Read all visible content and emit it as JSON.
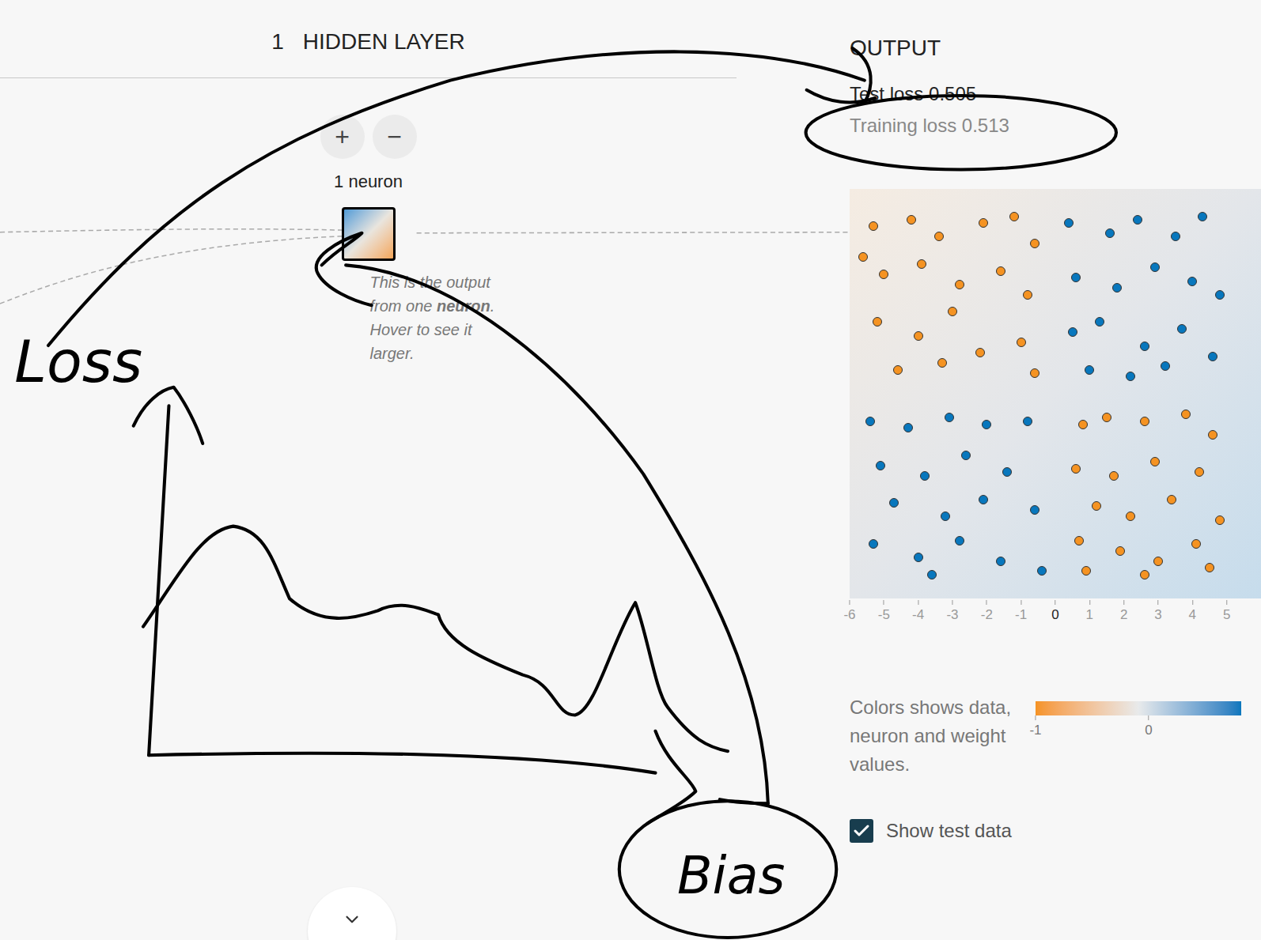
{
  "hidden_layer": {
    "count": "1",
    "title": "HIDDEN LAYER",
    "buttons": [
      "+",
      "−"
    ],
    "neurons_label": "1 neuron",
    "callout": [
      {
        "text": "This is the output from one ",
        "bold": false
      },
      {
        "text": "neuron",
        "bold": true
      },
      {
        "text": ". Hover to see it larger.",
        "bold": false
      }
    ]
  },
  "output": {
    "title": "OUTPUT",
    "test_loss": "Test loss 0.505",
    "training_loss": "Training loss 0.513"
  },
  "chart": {
    "x_ticks": [
      "-6",
      "-5",
      "-4",
      "-3",
      "-2",
      "-1",
      "0",
      "1",
      "2",
      "3",
      "4",
      "5"
    ],
    "series": [
      {
        "name": "orange",
        "color": "#f59322",
        "points": [
          [
            -5.3,
            4.9
          ],
          [
            -4.2,
            5.1
          ],
          [
            -3.4,
            4.6
          ],
          [
            -2.1,
            5.0
          ],
          [
            -1.2,
            5.2
          ],
          [
            -0.6,
            4.4
          ],
          [
            -5.0,
            3.5
          ],
          [
            -3.9,
            3.8
          ],
          [
            -2.8,
            3.2
          ],
          [
            -1.6,
            3.6
          ],
          [
            -0.8,
            2.9
          ],
          [
            -5.2,
            2.1
          ],
          [
            -4.0,
            1.7
          ],
          [
            -3.0,
            2.4
          ],
          [
            -2.2,
            1.2
          ],
          [
            -1.0,
            1.5
          ],
          [
            -4.6,
            0.7
          ],
          [
            -3.3,
            0.9
          ],
          [
            -0.6,
            0.6
          ],
          [
            -5.6,
            4.0
          ],
          [
            0.8,
            -0.9
          ],
          [
            1.5,
            -0.7
          ],
          [
            2.6,
            -0.8
          ],
          [
            3.8,
            -0.6
          ],
          [
            4.6,
            -1.2
          ],
          [
            0.6,
            -2.2
          ],
          [
            1.7,
            -2.4
          ],
          [
            2.9,
            -2.0
          ],
          [
            4.2,
            -2.3
          ],
          [
            1.2,
            -3.3
          ],
          [
            2.2,
            -3.6
          ],
          [
            3.4,
            -3.1
          ],
          [
            4.8,
            -3.7
          ],
          [
            0.7,
            -4.3
          ],
          [
            1.9,
            -4.6
          ],
          [
            3.0,
            -4.9
          ],
          [
            4.1,
            -4.4
          ],
          [
            0.9,
            -5.2
          ],
          [
            2.6,
            -5.3
          ],
          [
            4.5,
            -5.1
          ]
        ]
      },
      {
        "name": "blue",
        "color": "#0877bd",
        "points": [
          [
            0.4,
            5.0
          ],
          [
            1.6,
            4.7
          ],
          [
            2.4,
            5.1
          ],
          [
            3.5,
            4.6
          ],
          [
            4.3,
            5.2
          ],
          [
            0.6,
            3.4
          ],
          [
            1.8,
            3.1
          ],
          [
            2.9,
            3.7
          ],
          [
            4.0,
            3.3
          ],
          [
            4.8,
            2.9
          ],
          [
            0.5,
            1.8
          ],
          [
            1.3,
            2.1
          ],
          [
            2.6,
            1.4
          ],
          [
            3.7,
            1.9
          ],
          [
            4.6,
            1.1
          ],
          [
            1.0,
            0.7
          ],
          [
            2.2,
            0.5
          ],
          [
            3.2,
            0.8
          ],
          [
            -5.4,
            -0.8
          ],
          [
            -4.3,
            -1.0
          ],
          [
            -3.1,
            -0.7
          ],
          [
            -2.0,
            -0.9
          ],
          [
            -0.8,
            -0.8
          ],
          [
            -5.1,
            -2.1
          ],
          [
            -3.8,
            -2.4
          ],
          [
            -2.6,
            -1.8
          ],
          [
            -1.4,
            -2.3
          ],
          [
            -4.7,
            -3.2
          ],
          [
            -3.2,
            -3.6
          ],
          [
            -2.1,
            -3.1
          ],
          [
            -0.6,
            -3.4
          ],
          [
            -5.3,
            -4.4
          ],
          [
            -4.0,
            -4.8
          ],
          [
            -2.8,
            -4.3
          ],
          [
            -1.6,
            -4.9
          ],
          [
            -0.4,
            -5.2
          ],
          [
            -3.6,
            -5.3
          ]
        ]
      }
    ]
  },
  "legend": {
    "text": "Colors shows data, neuron and weight values.",
    "ticks": [
      "-1",
      "0"
    ]
  },
  "show_test_data": {
    "label": "Show test data",
    "checked": true
  },
  "annotations": {
    "loss_label": "Loss",
    "bias_label": "Bias"
  }
}
